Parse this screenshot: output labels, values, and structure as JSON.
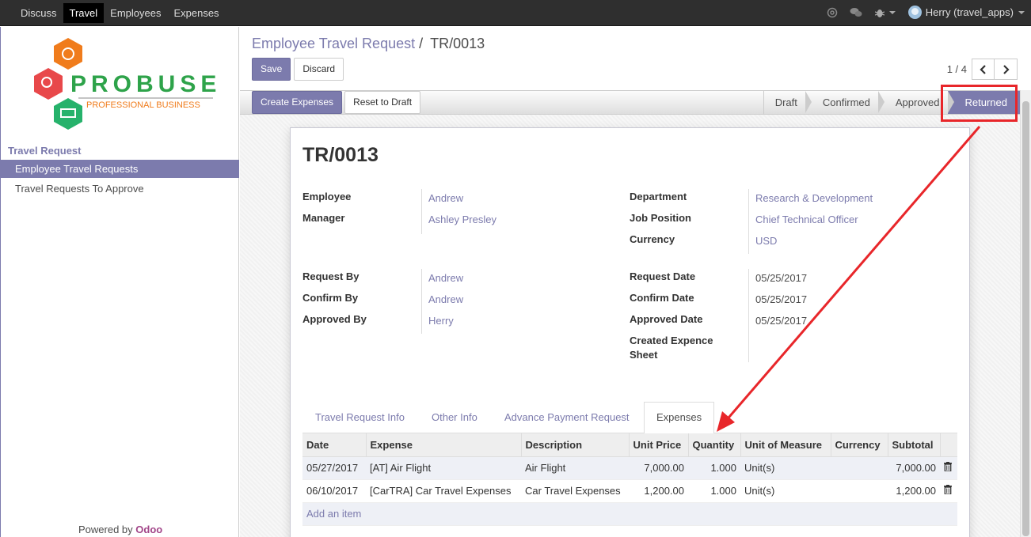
{
  "topbar": {
    "menu": [
      "Discuss",
      "Travel",
      "Employees",
      "Expenses"
    ],
    "active_index": 1,
    "user": "Herry (travel_apps)"
  },
  "sidebar": {
    "logo_text": "PROBUSE",
    "logo_sub": "PROFESSIONAL BUSINESS",
    "section": "Travel Request",
    "items": [
      {
        "label": "Employee Travel Requests",
        "active": true
      },
      {
        "label": "Travel Requests To Approve",
        "active": false
      }
    ],
    "powered": "Powered by",
    "powered_brand": "Odoo"
  },
  "control": {
    "breadcrumb_parent": "Employee Travel Request",
    "breadcrumb_sep": "/",
    "breadcrumb_current": "TR/0013",
    "save_label": "Save",
    "discard_label": "Discard",
    "pager": "1 / 4"
  },
  "statusbar": {
    "create_expenses_label": "Create Expenses",
    "reset_label": "Reset to Draft",
    "stages": [
      "Draft",
      "Confirmed",
      "Approved",
      "Returned"
    ],
    "current_stage": "Returned"
  },
  "form": {
    "title": "TR/0013",
    "left1": [
      {
        "label": "Employee",
        "value": "Andrew"
      },
      {
        "label": "Manager",
        "value": "Ashley Presley"
      }
    ],
    "right1": [
      {
        "label": "Department",
        "value": "Research & Development"
      },
      {
        "label": "Job Position",
        "value": "Chief Technical Officer"
      },
      {
        "label": "Currency",
        "value": "USD"
      }
    ],
    "left2": [
      {
        "label": "Request By",
        "value": "Andrew"
      },
      {
        "label": "Confirm By",
        "value": "Andrew"
      },
      {
        "label": "Approved By",
        "value": "Herry"
      }
    ],
    "right2": [
      {
        "label": "Request Date",
        "value": "05/25/2017"
      },
      {
        "label": "Confirm Date",
        "value": "05/25/2017"
      },
      {
        "label": "Approved Date",
        "value": "05/25/2017"
      },
      {
        "label": "Created Expence Sheet",
        "value": ""
      }
    ],
    "tabs": [
      "Travel Request Info",
      "Other Info",
      "Advance Payment Request",
      "Expenses"
    ],
    "active_tab": "Expenses",
    "columns": [
      "Date",
      "Expense",
      "Description",
      "Unit Price",
      "Quantity",
      "Unit of Measure",
      "Currency",
      "Subtotal"
    ],
    "rows": [
      {
        "date": "05/27/2017",
        "expense": "[AT] Air Flight",
        "description": "Air Flight",
        "unit_price": "7,000.00",
        "quantity": "1.000",
        "uom": "Unit(s)",
        "currency": "",
        "subtotal": "7,000.00"
      },
      {
        "date": "06/10/2017",
        "expense": "[CarTRA] Car Travel Expenses",
        "description": "Car Travel Expenses",
        "unit_price": "1,200.00",
        "quantity": "1.000",
        "uom": "Unit(s)",
        "currency": "",
        "subtotal": "1,200.00"
      }
    ],
    "add_item": "Add an item"
  },
  "colors": {
    "accent": "#7c7bad",
    "annotation": "#e8262a"
  }
}
